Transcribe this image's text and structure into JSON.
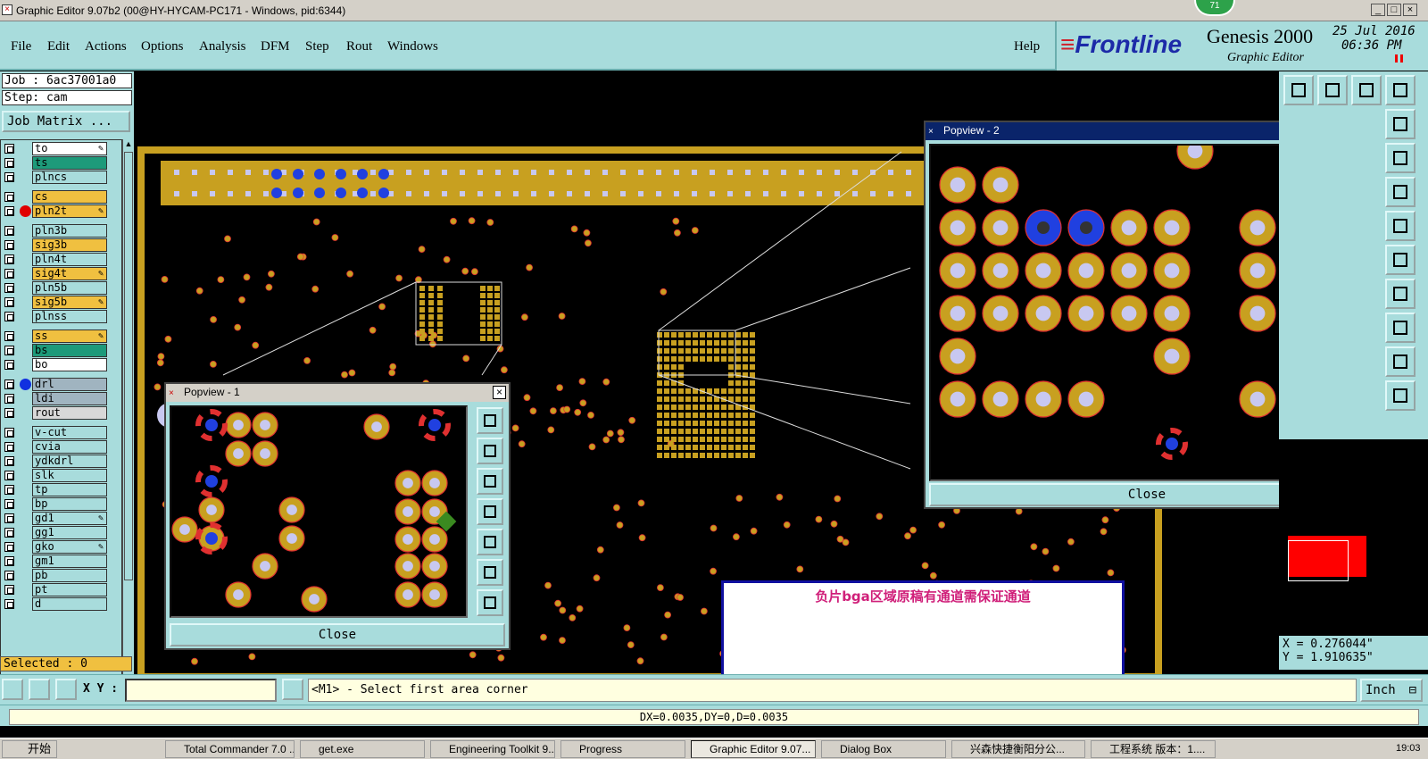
{
  "window": {
    "title": "Graphic Editor 9.07b2 (00@HY-HYCAM-PC171 - Windows, pid:6344)",
    "badge": "71"
  },
  "menu": [
    "File",
    "Edit",
    "Actions",
    "Options",
    "Analysis",
    "DFM",
    "Step",
    "Rout",
    "Windows"
  ],
  "help_label": "Help",
  "brand": {
    "logo": "Frontline",
    "product": "Genesis 2000",
    "subtitle": "Graphic Editor",
    "date": "25 Jul 2016",
    "time": "06:36 PM"
  },
  "job": {
    "job_line": "Job : 6ac37001a0",
    "step_line": "Step: cam",
    "matrix_button": "Job Matrix ..."
  },
  "layers": [
    {
      "name": "to",
      "color": "#ffffff",
      "dot": "",
      "edit": true
    },
    {
      "name": "ts",
      "color": "#1d9a7a",
      "dot": "",
      "edit": false
    },
    {
      "name": "plncs",
      "color": "#a8dcdc",
      "dot": "",
      "edit": false
    },
    {
      "name": "cs",
      "color": "#f0c040",
      "dot": "",
      "edit": false
    },
    {
      "name": "pln2t",
      "color": "#f0c040",
      "dot": "#e00000",
      "edit": true
    },
    {
      "name": "pln3b",
      "color": "#a8dcdc",
      "dot": "",
      "edit": false
    },
    {
      "name": "sig3b",
      "color": "#f0c040",
      "dot": "",
      "edit": false
    },
    {
      "name": "pln4t",
      "color": "#a8dcdc",
      "dot": "",
      "edit": false
    },
    {
      "name": "sig4t",
      "color": "#f0c040",
      "dot": "",
      "edit": true
    },
    {
      "name": "pln5b",
      "color": "#a8dcdc",
      "dot": "",
      "edit": false
    },
    {
      "name": "sig5b",
      "color": "#f0c040",
      "dot": "",
      "edit": true
    },
    {
      "name": "plnss",
      "color": "#a8dcdc",
      "dot": "",
      "edit": false
    },
    {
      "name": "ss",
      "color": "#f0c040",
      "dot": "",
      "edit": true
    },
    {
      "name": "bs",
      "color": "#1d9a7a",
      "dot": "",
      "edit": false
    },
    {
      "name": "bo",
      "color": "#ffffff",
      "dot": "",
      "edit": false
    },
    {
      "name": "drl",
      "color": "#a0b4c0",
      "dot": "#1030e0",
      "edit": false
    },
    {
      "name": "ldi",
      "color": "#a0b4c0",
      "dot": "",
      "edit": false
    },
    {
      "name": "rout",
      "color": "#d8d8d8",
      "dot": "",
      "edit": false
    },
    {
      "name": "v-cut",
      "color": "#a8dcdc",
      "dot": "",
      "edit": false
    },
    {
      "name": "cvia",
      "color": "#a8dcdc",
      "dot": "",
      "edit": false
    },
    {
      "name": "ydkdrl",
      "color": "#a8dcdc",
      "dot": "",
      "edit": false
    },
    {
      "name": "slk",
      "color": "#a8dcdc",
      "dot": "",
      "edit": false
    },
    {
      "name": "tp",
      "color": "#a8dcdc",
      "dot": "",
      "edit": false
    },
    {
      "name": "bp",
      "color": "#a8dcdc",
      "dot": "",
      "edit": false
    },
    {
      "name": "gd1",
      "color": "#a8dcdc",
      "dot": "",
      "edit": true
    },
    {
      "name": "gg1",
      "color": "#a8dcdc",
      "dot": "",
      "edit": false
    },
    {
      "name": "gko",
      "color": "#a8dcdc",
      "dot": "",
      "edit": true
    },
    {
      "name": "gm1",
      "color": "#a8dcdc",
      "dot": "",
      "edit": false
    },
    {
      "name": "pb",
      "color": "#a8dcdc",
      "dot": "",
      "edit": false
    },
    {
      "name": "pt",
      "color": "#a8dcdc",
      "dot": "",
      "edit": false
    },
    {
      "name": "d",
      "color": "#a8dcdc",
      "dot": "",
      "edit": false
    }
  ],
  "selected_label": "Selected : 0",
  "popview1": {
    "title": "Popview - 1",
    "close": "Close"
  },
  "popview2": {
    "title": "Popview - 2",
    "close": "Close"
  },
  "note_text": "负片bga区域原稿有通道需保证通道",
  "coords": {
    "x": "X = 0.276044\"",
    "y": "Y = 1.910635\""
  },
  "command": {
    "xy_label": "X Y :",
    "xy_value": "",
    "message": "<M1> - Select first area corner",
    "unit": "Inch"
  },
  "status_text": "DX=0.0035,DY=0,D=0.0035",
  "taskbar": {
    "start": "开始",
    "items": [
      "Total Commander 7.0 ...",
      "get.exe",
      "Engineering Toolkit 9....",
      "Progress",
      "Graphic Editor 9.07...",
      "Dialog Box",
      "兴森快捷衡阳分公...",
      "工程系统  版本：1...."
    ],
    "clock": "19:03"
  },
  "colors": {
    "panel": "#a8dcdc",
    "pad": "#c8a020",
    "pad_edge": "#e03030",
    "drill": "#c8c8f0",
    "highlight": "#2040e0"
  }
}
